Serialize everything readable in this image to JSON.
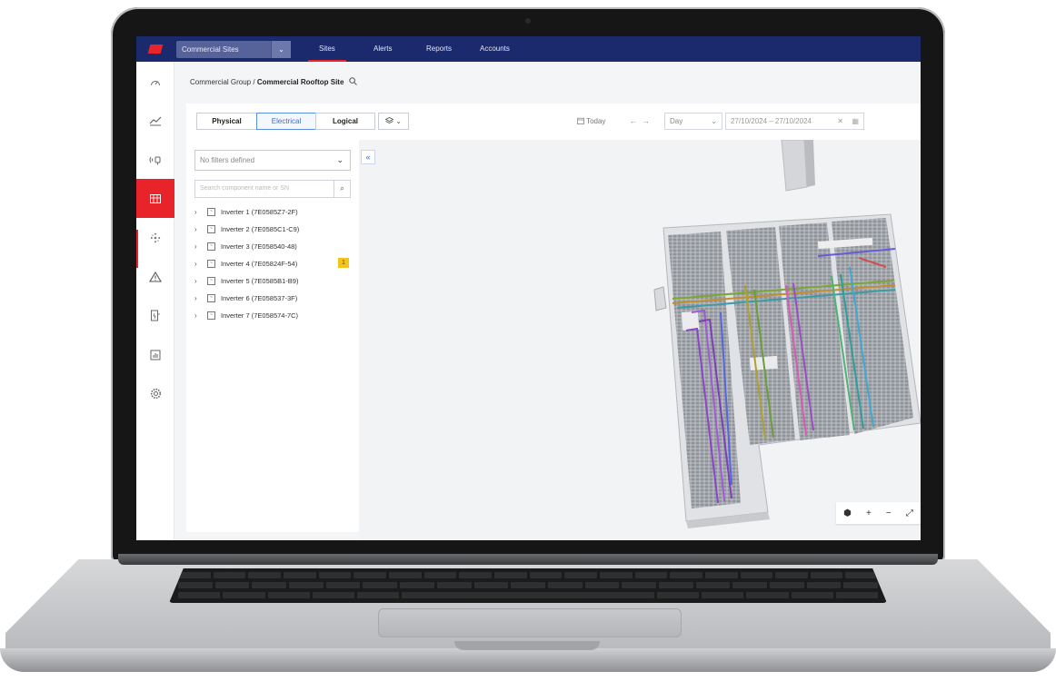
{
  "topnav": {
    "site_select": "Commercial Sites",
    "tabs": [
      "Sites",
      "Alerts",
      "Reports",
      "Accounts"
    ],
    "active_tab": "Sites"
  },
  "breadcrumb": {
    "group": "Commercial Group",
    "separator": "/",
    "site": "Commercial Rooftop Site"
  },
  "toolbar": {
    "views": [
      "Physical",
      "Electrical",
      "Logical"
    ],
    "active_view": "Electrical",
    "today_label": "Today",
    "period": "Day",
    "date_range": "27/10/2024 – 27/10/2024"
  },
  "panel": {
    "filter_placeholder": "No filters defined",
    "search_placeholder": "Search component name or SN",
    "inverters": [
      {
        "label": "Inverter 1 (7E0585Z7-2F)"
      },
      {
        "label": "Inverter 2 (7E0585C1-C9)"
      },
      {
        "label": "Inverter 3 (7E058540-48)"
      },
      {
        "label": "Inverter 4 (7E05824F-54)",
        "alert": "1"
      },
      {
        "label": "Inverter 5 (7E0585B1-B9)"
      },
      {
        "label": "Inverter 6 (7E058537-3F)"
      },
      {
        "label": "Inverter 7 (7E058574-7C)"
      }
    ]
  },
  "icons": {
    "rail": [
      "dashboard-icon",
      "performance-chart-icon",
      "energy-icon",
      "site-layout-icon",
      "components-icon",
      "alerts-icon",
      "devices-icon",
      "reports-icon",
      "settings-icon"
    ],
    "active": "site-layout-icon"
  },
  "colors": {
    "nav_bg": "#1a2a6c",
    "accent": "#e8232a",
    "selected_view": "#3b6fc4",
    "alert_badge": "#f2c51d"
  }
}
